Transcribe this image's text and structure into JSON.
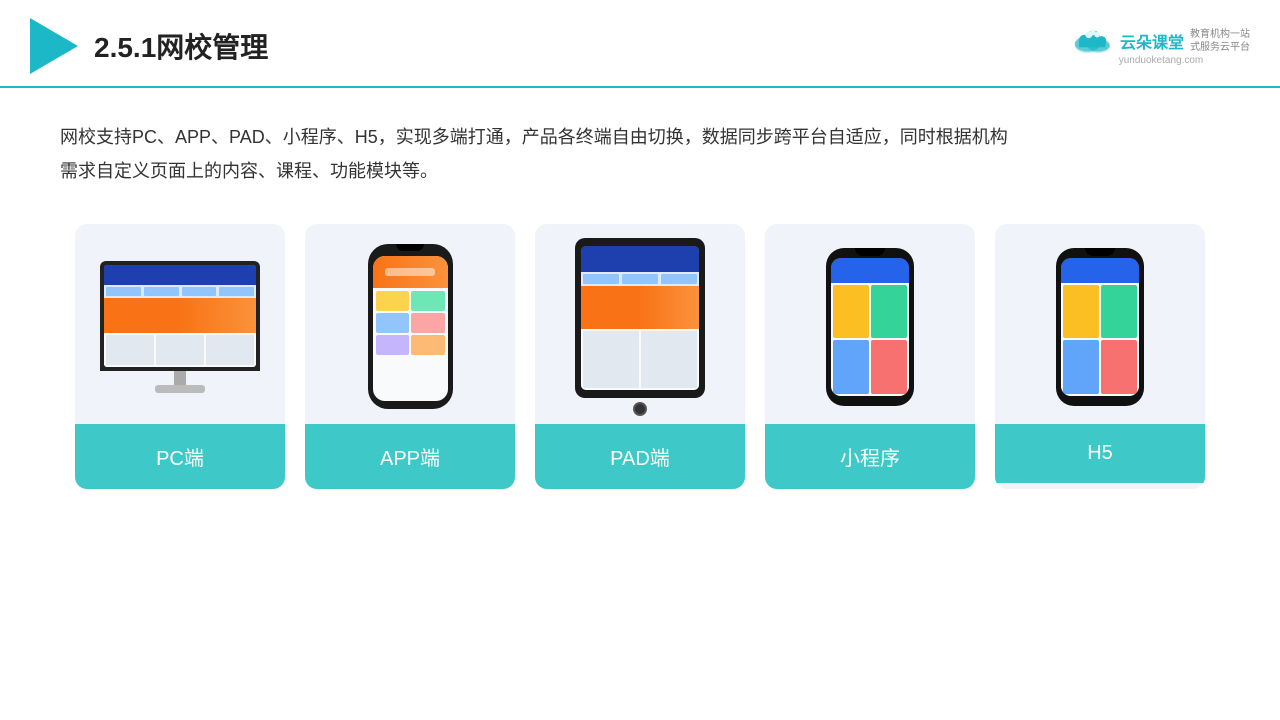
{
  "header": {
    "title": "2.5.1网校管理",
    "brand": {
      "name": "云朵课堂",
      "url": "yunduoketang.com",
      "slogan": "教育机构一站\n式服务云平台"
    }
  },
  "description": "网校支持PC、APP、PAD、小程序、H5，实现多端打通，产品各终端自由切换，数据同步跨平台自适应，同时根据机构\n需求自定义页面上的内容、课程、功能模块等。",
  "cards": [
    {
      "id": "pc",
      "label": "PC端",
      "device": "monitor"
    },
    {
      "id": "app",
      "label": "APP端",
      "device": "phone"
    },
    {
      "id": "pad",
      "label": "PAD端",
      "device": "tablet"
    },
    {
      "id": "miniprogram",
      "label": "小程序",
      "device": "phone"
    },
    {
      "id": "h5",
      "label": "H5",
      "device": "phone"
    }
  ],
  "colors": {
    "accent": "#1cb8c8",
    "cardBg": "#eef2f8",
    "labelBg": "#3ec8c8"
  }
}
